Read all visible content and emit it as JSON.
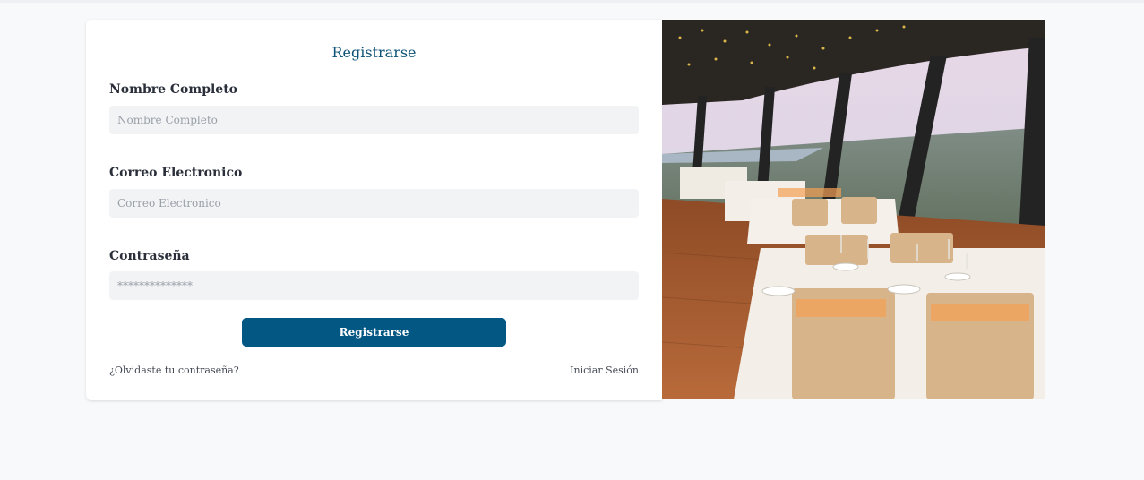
{
  "form": {
    "title": "Registrarse",
    "name_label": "Nombre Completo",
    "name_placeholder": "Nombre Completo",
    "email_label": "Correo Electronico",
    "email_placeholder": "Correo Electronico",
    "password_label": "Contraseña",
    "password_placeholder": "**************",
    "submit_label": "Registrarse",
    "forgot_link": "¿Olvidaste tu contraseña?",
    "login_link": "Iniciar Sesión"
  },
  "colors": {
    "accent": "#035783",
    "title": "#0e5478",
    "background": "#f8f9fb",
    "field_bg": "#f2f3f5"
  },
  "image": {
    "subject": "restaurant-photo"
  }
}
